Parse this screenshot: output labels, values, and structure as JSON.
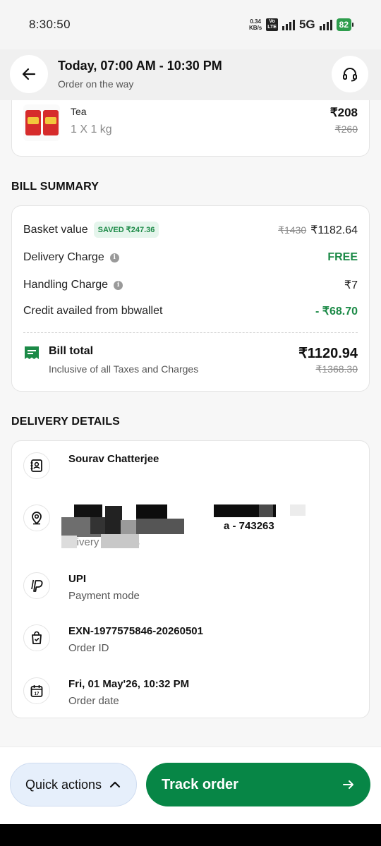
{
  "status_bar": {
    "time": "8:30:50",
    "net_speed_value": "0.34",
    "net_speed_unit": "KB/s",
    "volte_top": "Vo",
    "volte_bottom": "LTE",
    "network": "5G",
    "battery": "82"
  },
  "header": {
    "title": "Today, 07:00 AM - 10:30 PM",
    "subtitle": "Order on the way"
  },
  "product": {
    "name": "Tea",
    "quantity": "1 X 1 kg",
    "price": "₹208",
    "mrp": "₹260"
  },
  "bill": {
    "section_title": "BILL SUMMARY",
    "basket_label": "Basket value",
    "saved_badge": "SAVED ₹247.36",
    "basket_mrp": "₹1430",
    "basket_value": "₹1182.64",
    "delivery_label": "Delivery Charge",
    "delivery_value": "FREE",
    "handling_label": "Handling Charge",
    "handling_value": "₹7",
    "credit_label": "Credit availed from bbwallet",
    "credit_value": "- ₹68.70",
    "total_label": "Bill total",
    "total_sub": "Inclusive of all Taxes and Charges",
    "total_value": "₹1120.94",
    "total_mrp": "₹1368.30"
  },
  "delivery": {
    "section_title": "DELIVERY DETAILS",
    "name": "Sourav Chatterjee",
    "address_partial": "a - 743263",
    "address_sub_partial": "elivery address",
    "payment_title": "UPI",
    "payment_sub": "Payment mode",
    "order_id": "EXN-1977575846-20260501",
    "order_id_sub": "Order ID",
    "order_date": "Fri, 01 May'26, 10:32 PM",
    "order_date_sub": "Order date"
  },
  "actions": {
    "quick": "Quick actions",
    "track": "Track order"
  },
  "colors": {
    "brand_green": "#078646",
    "accent_green": "#1c8a47",
    "quick_bg": "#e6effb"
  }
}
